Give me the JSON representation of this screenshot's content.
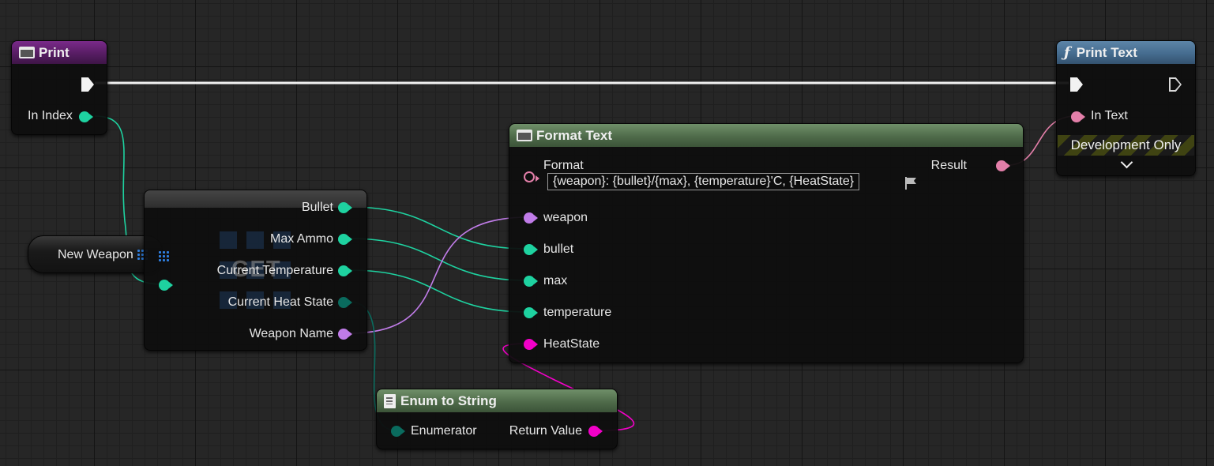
{
  "nodes": {
    "print": {
      "title": "Print",
      "pin_in_index": "In Index"
    },
    "print_text": {
      "title": "Print Text",
      "pin_in_text": "In Text",
      "dev_only": "Development Only"
    },
    "format_text": {
      "title": "Format Text",
      "pin_format": "Format",
      "format_value": "{weapon}: {bullet}/{max}, {temperature}'C, {HeatState}",
      "pin_result": "Result",
      "pin_weapon": "weapon",
      "pin_bullet": "bullet",
      "pin_max": "max",
      "pin_temperature": "temperature",
      "pin_heatstate": "HeatState"
    },
    "new_weapon": {
      "label": "New Weapon"
    },
    "get_struct": {
      "watermark": "GET",
      "pin_bullet": "Bullet",
      "pin_max_ammo": "Max Ammo",
      "pin_current_temperature": "Current Temperature",
      "pin_current_heat_state": "Current Heat State",
      "pin_weapon_name": "Weapon Name"
    },
    "enum_to_string": {
      "title": "Enum to String",
      "pin_enumerator": "Enumerator",
      "pin_return_value": "Return Value"
    }
  },
  "colors": {
    "integer_pin": "#1ed2a0",
    "enum_pin": "#0a6b5e",
    "string_pin": "#c07ce8",
    "text_pin": "#e37fa9",
    "enum_string_pin": "#f200c8",
    "exec_wire": "#f2f2f2"
  },
  "icons": {
    "print_header": "event-node-icon",
    "print_text_header": "function-icon",
    "format_text_header": "node-icon",
    "enum_to_string_header": "document-icon",
    "new_weapon_type": "struct-grid-icon",
    "format_localize": "flag-icon",
    "dev_only_expand": "chevron-down-icon"
  }
}
